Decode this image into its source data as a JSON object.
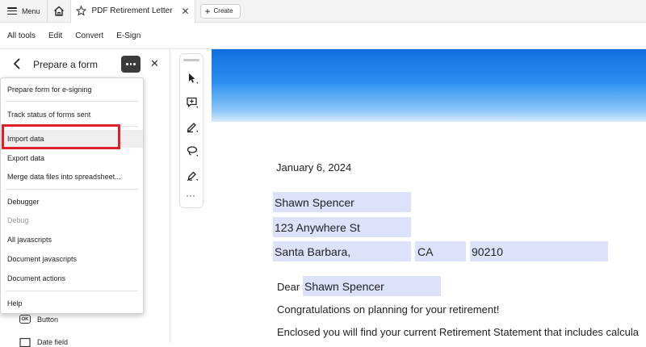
{
  "tabbar": {
    "menu_label": "Menu",
    "doc_tab_title": "PDF Retirement Letter St...",
    "close_glyph": "✕",
    "create_label": "Create",
    "create_plus": "+"
  },
  "tools": {
    "items": [
      "All tools",
      "Edit",
      "Convert",
      "E-Sign"
    ]
  },
  "panel": {
    "title": "Prepare a form",
    "close_glyph": "✕",
    "bottom_items": [
      {
        "label": "Button",
        "icon": "ok-button-icon"
      },
      {
        "label": "Date field",
        "icon": "calendar-icon"
      }
    ]
  },
  "dropdown": {
    "items": [
      {
        "label": "Prepare form for e-signing",
        "enabled": true
      },
      {
        "label": "Track status of forms sent",
        "enabled": true
      },
      {
        "label": "Import data",
        "enabled": true,
        "highlighted": true
      },
      {
        "label": "Export data",
        "enabled": true
      },
      {
        "label": "Merge data files into spreadsheet...",
        "enabled": true
      },
      {
        "label": "Debugger",
        "enabled": true
      },
      {
        "label": "Debug",
        "enabled": false
      },
      {
        "label": "All javascripts",
        "enabled": true
      },
      {
        "label": "Document javascripts",
        "enabled": true
      },
      {
        "label": "Document actions",
        "enabled": true
      },
      {
        "label": "Help",
        "enabled": true
      }
    ],
    "highlight_color": "#e0202a"
  },
  "rail": {
    "tools": [
      "select-arrow-icon",
      "add-comment-icon",
      "highlight-pen-icon",
      "lasso-draw-icon",
      "fill-sign-icon"
    ],
    "more_glyph": "···"
  },
  "document": {
    "date": "January 6, 2024",
    "name_field": "Shawn Spencer",
    "address_field": "123 Anywhere St",
    "city_field": "Santa Barbara,",
    "state_field": "CA",
    "zip_field": "90210",
    "salutation": "Dear",
    "salutation_name": "Shawn Spencer",
    "line1": "Congratulations on planning for your retirement!",
    "line2": "Enclosed you will find your current Retirement Statement that includes calcula",
    "field_color": "#dde2fb",
    "banner_color": "#1c7fe6"
  }
}
